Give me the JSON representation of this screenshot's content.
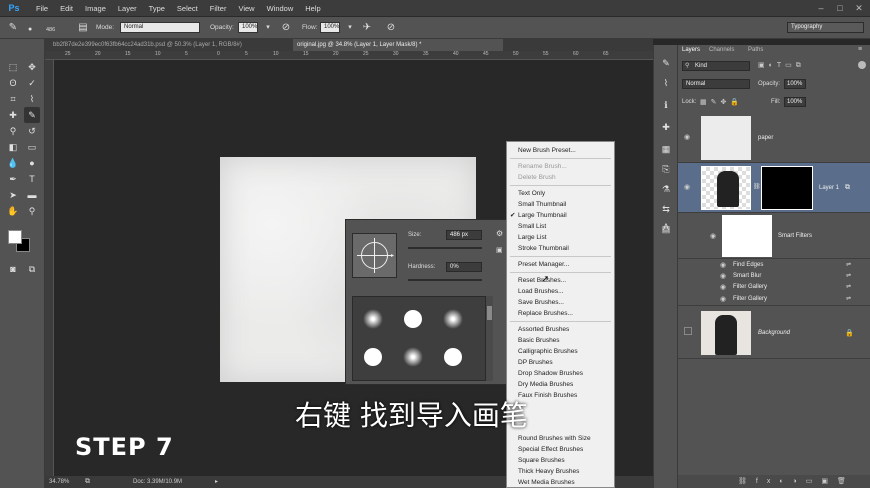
{
  "menubar": {
    "logo": "Ps",
    "items": [
      "File",
      "Edit",
      "Image",
      "Layer",
      "Type",
      "Select",
      "Filter",
      "View",
      "Window",
      "Help"
    ],
    "minimize": "–",
    "maximize": "□",
    "close": "✕"
  },
  "options": {
    "brush_size": "486",
    "mode_label": "Mode:",
    "mode_value": "Normal",
    "opacity_label": "Opacity:",
    "opacity_value": "100%",
    "flow_label": "Flow:",
    "flow_value": "100%",
    "workspace": "Typography"
  },
  "tabs": [
    {
      "label": "bb2f87de2e399ec0f63fb64cc24ad31b.psd @ 50.3% (Layer 1, RGB/8#)"
    },
    {
      "label": "original.jpg @ 34.8% (Layer 1, Layer Mask/8) *"
    }
  ],
  "ruler": {
    "ticks": [
      "25",
      "20",
      "15",
      "10",
      "5",
      "0",
      "5",
      "10",
      "15",
      "20",
      "25",
      "30",
      "35",
      "40",
      "45",
      "50",
      "55",
      "60",
      "65"
    ]
  },
  "status": {
    "zoom": "34.78%",
    "doc": "Doc: 3.39M/10.9M"
  },
  "brush_panel": {
    "size_label": "Size:",
    "size_value": "486 px",
    "hardness_label": "Hardness:",
    "hardness_value": "0%"
  },
  "context_menu": {
    "items": [
      "New Brush Preset...",
      "Rename Brush...",
      "Delete Brush",
      "Text Only",
      "Small Thumbnail",
      "Large Thumbnail",
      "Small List",
      "Large List",
      "Stroke Thumbnail",
      "Preset Manager...",
      "Reset Brushes...",
      "Load Brushes...",
      "Save Brushes...",
      "Replace Brushes...",
      "Assorted Brushes",
      "Basic Brushes",
      "Calligraphic Brushes",
      "DP Brushes",
      "Drop Shadow Brushes",
      "Dry Media Brushes",
      "Faux Finish Brushes",
      "Round Brushes with Size",
      "Special Effect Brushes",
      "Square Brushes",
      "Thick Heavy Brushes",
      "Wet Media Brushes"
    ],
    "checked": "Large Thumbnail"
  },
  "layers": {
    "tabs": [
      "Layers",
      "Channels",
      "Paths"
    ],
    "kind": "Kind",
    "blend": "Normal",
    "opacity_label": "Opacity:",
    "opacity_value": "100%",
    "lock_label": "Lock:",
    "fill_label": "Fill:",
    "fill_value": "100%",
    "names": {
      "paper": "paper",
      "layer1": "Layer 1",
      "smart_filters": "Smart Filters",
      "find_edges": "Find Edges",
      "smart_blur": "Smart Blur",
      "filter_gallery_1": "Filter Gallery",
      "filter_gallery_2": "Filter Gallery",
      "background": "Background"
    }
  },
  "overlay": {
    "subtitle": "右键 找到导入画笔",
    "step": "STEP 7"
  },
  "colors": {
    "accent": "#31a8ff",
    "selected_layer": "#5a6d8a"
  }
}
